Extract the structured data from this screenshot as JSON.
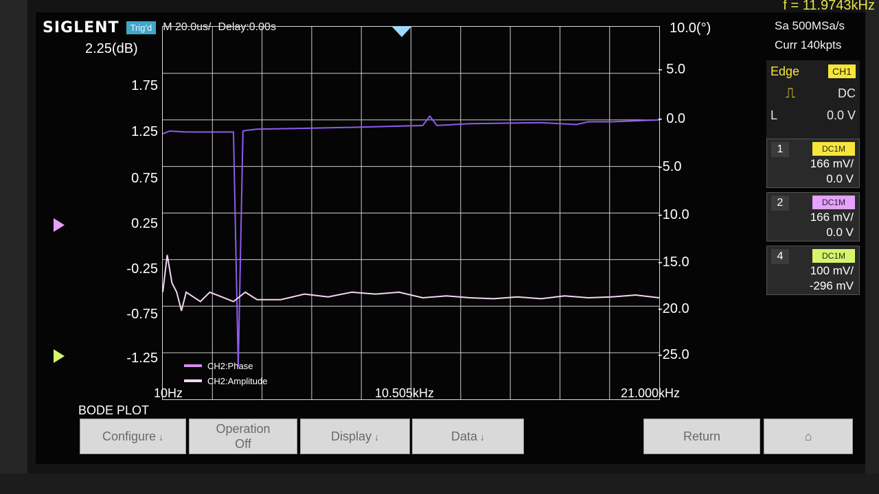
{
  "device": {
    "logo": "SIGLENT",
    "mode_badge": "Trig'd",
    "timebase": "M 20.0us/",
    "delay": "Delay:0.00s",
    "frequency_readout": "f = 11.9743kHz"
  },
  "acquisition": {
    "sample_rate": "Sa 500MSa/s",
    "memory_depth": "Curr 140kpts"
  },
  "trigger": {
    "type_label": "Edge",
    "source": "CH1",
    "slope_icon": "rising-edge-icon",
    "coupling": "DC",
    "level_prefix": "L",
    "level": "0.0 V"
  },
  "channels": [
    {
      "num": "1",
      "tag": "DC1M",
      "color": "#f7e63a",
      "scale": "166 mV/",
      "offset": "0.0 V"
    },
    {
      "num": "2",
      "tag": "DC1M",
      "color": "#e6a0ff",
      "scale": "166 mV/",
      "offset": "0.0 V"
    },
    {
      "num": "4",
      "tag": "DC1M",
      "color": "#d6f56a",
      "scale": "100 mV/",
      "offset": "-296 mV"
    }
  ],
  "plot": {
    "title": "BODE PLOT",
    "left_axis_title": "2.25(dB)",
    "left_ticks": [
      "1.75",
      "1.25",
      "0.75",
      "0.25",
      "-0.25",
      "-0.75",
      "-1.25"
    ],
    "right_axis_title": "10.0(°)",
    "right_ticks": [
      "5.0",
      "0.0",
      "-5.0",
      "-10.0",
      "-15.0",
      "-20.0",
      "-25.0"
    ],
    "x_labels": [
      "10Hz",
      "10.505kHz",
      "21.000kHz"
    ],
    "legend": [
      {
        "label": "CH2:Phase",
        "color": "#d58cf2"
      },
      {
        "label": "CH2:Amplitude",
        "color": "#f4d8f4"
      }
    ]
  },
  "chart_data": {
    "type": "line",
    "x_range_hz": [
      10,
      21000
    ],
    "left_axis_range_db": [
      -1.75,
      2.25
    ],
    "right_axis_range_deg": [
      -30,
      10
    ],
    "grid": true,
    "series": [
      {
        "name": "CH2:Phase",
        "axis": "right",
        "color": "#8e5cf0",
        "x": [
          10,
          300,
          1000,
          3000,
          3200,
          3400,
          3600,
          4000,
          6000,
          8000,
          11000,
          11300,
          11600,
          13000,
          16000,
          17500,
          18000,
          19000,
          21000
        ],
        "y": [
          -1.5,
          -1.2,
          -1.3,
          -1.3,
          -26.5,
          -1.2,
          -1.1,
          -1.0,
          -0.9,
          -0.8,
          -0.6,
          0.4,
          -0.6,
          -0.4,
          -0.3,
          -0.5,
          -0.2,
          -0.2,
          0.0
        ]
      },
      {
        "name": "CH2:Amplitude",
        "axis": "left",
        "color": "#f4d8f4",
        "x": [
          10,
          200,
          400,
          600,
          800,
          1000,
          1300,
          1600,
          2000,
          2500,
          3000,
          3500,
          4000,
          5000,
          6000,
          7000,
          8000,
          9000,
          10000,
          11000,
          12000,
          13000,
          14000,
          15000,
          16000,
          17000,
          18000,
          19000,
          20000,
          21000
        ],
        "y": [
          -0.6,
          -0.2,
          -0.5,
          -0.6,
          -0.8,
          -0.6,
          -0.65,
          -0.7,
          -0.6,
          -0.65,
          -0.7,
          -0.6,
          -0.68,
          -0.68,
          -0.62,
          -0.65,
          -0.6,
          -0.62,
          -0.6,
          -0.66,
          -0.64,
          -0.66,
          -0.67,
          -0.65,
          -0.67,
          -0.64,
          -0.66,
          -0.65,
          -0.63,
          -0.66
        ]
      }
    ]
  },
  "softkeys": [
    {
      "label": "Configure",
      "sub": "",
      "arrow": "↓"
    },
    {
      "label": "Operation",
      "sub": "Off",
      "arrow": ""
    },
    {
      "label": "Display",
      "sub": "",
      "arrow": "↓"
    },
    {
      "label": "Data",
      "sub": "",
      "arrow": "↓"
    },
    {
      "label": "",
      "sub": "",
      "arrow": ""
    },
    {
      "label": "Return",
      "sub": "",
      "arrow": ""
    },
    {
      "label": "",
      "sub": "",
      "arrow": ""
    }
  ]
}
